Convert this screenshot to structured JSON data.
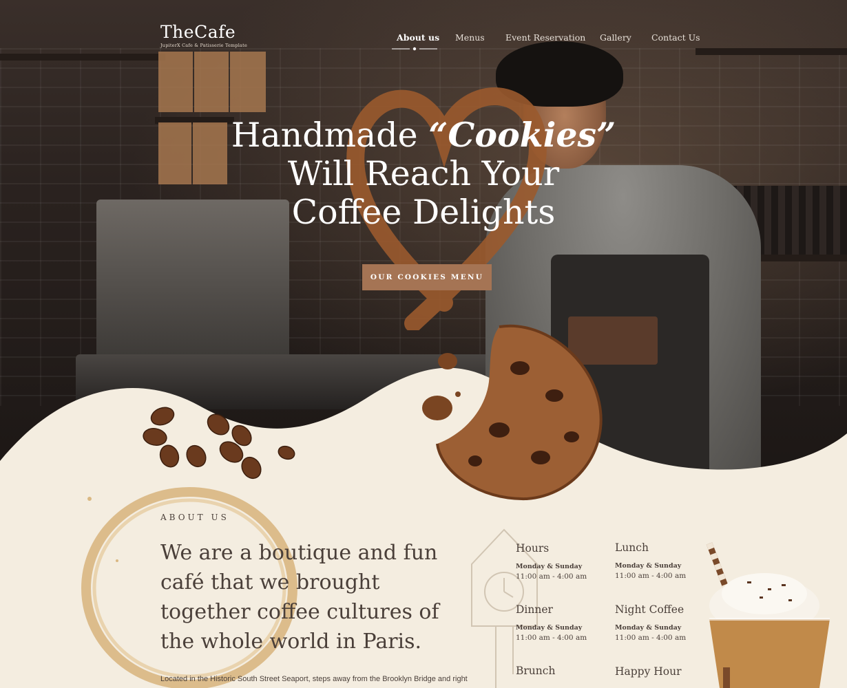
{
  "brand": {
    "name": "TheCafe",
    "tagline": "JupiterX Cafe & Patisserie Template"
  },
  "nav": {
    "items": [
      {
        "label": "About us",
        "active": true
      },
      {
        "label": "Menus",
        "active": false
      },
      {
        "label": "Event Reservation",
        "active": false
      },
      {
        "label": "Gallery",
        "active": false
      },
      {
        "label": "Contact Us",
        "active": false
      }
    ]
  },
  "hero": {
    "line1_prefix": "Handmade ",
    "line1_script": "“Cookies”",
    "line2": "Will Reach Your",
    "line3": "Coffee Delights",
    "cta_label": "OUR COOKIES MENU"
  },
  "about": {
    "label": "ABOUT US",
    "title": "We are a boutique and fun café that we brought together coffee cultures of the whole world in Paris.",
    "text": "Located in the Historic South Street Seaport, steps away from the Brooklyn Bridge and right"
  },
  "hours": [
    {
      "title": "Hours",
      "days": "Monday & Sunday",
      "time": "11:00 am - 4:00 am"
    },
    {
      "title": "Lunch",
      "days": "Monday & Sunday",
      "time": "11:00 am - 4:00 am"
    },
    {
      "title": "Dinner",
      "days": "Monday & Sunday",
      "time": "11:00 am - 4:00 am"
    },
    {
      "title": "Night Coffee",
      "days": "Monday & Sunday",
      "time": "11:00 am - 4:00 am"
    },
    {
      "title": "Brunch",
      "days": "",
      "time": ""
    },
    {
      "title": "Happy Hour",
      "days": "",
      "time": ""
    }
  ],
  "colors": {
    "accent": "#a57454",
    "text_dark": "#4a3f39",
    "cream": "#f4ede0"
  }
}
